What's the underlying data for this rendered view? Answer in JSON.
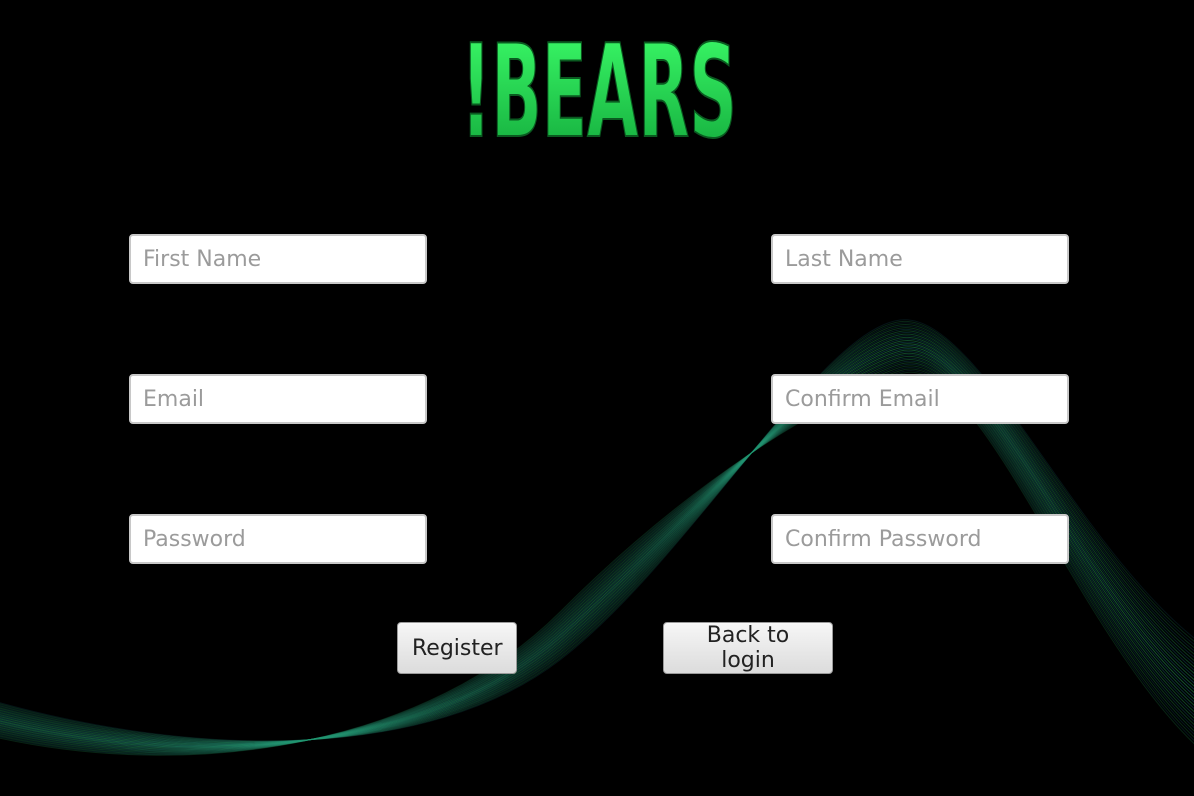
{
  "app": {
    "logo_text": "!BEARS"
  },
  "form": {
    "first_name": {
      "placeholder": "First Name",
      "value": ""
    },
    "last_name": {
      "placeholder": "Last Name",
      "value": ""
    },
    "email": {
      "placeholder": "Email",
      "value": ""
    },
    "confirm_email": {
      "placeholder": "Confirm Email",
      "value": ""
    },
    "password": {
      "placeholder": "Password",
      "value": ""
    },
    "confirm_password": {
      "placeholder": "Confirm Password",
      "value": ""
    }
  },
  "actions": {
    "register_label": "Register",
    "back_label": "Back to login"
  },
  "colors": {
    "background": "#000000",
    "logo_green": "#22e052",
    "wave_green": "#2fbf6a",
    "wave_teal": "#1c6f80"
  }
}
